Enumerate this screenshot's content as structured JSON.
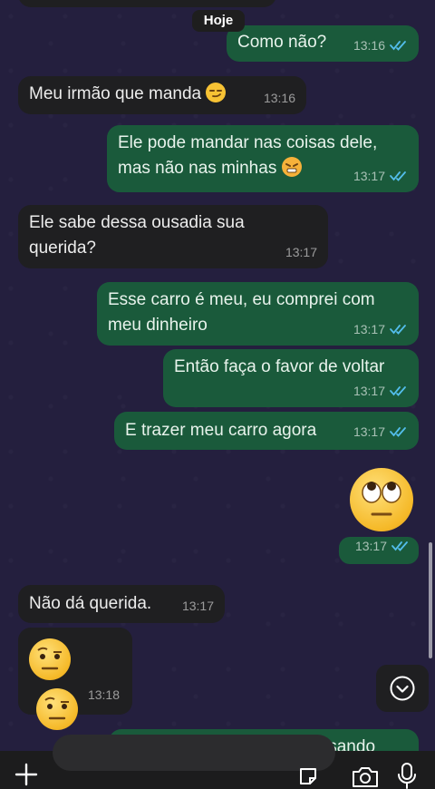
{
  "date_chip": "Hoje",
  "messages": [
    {
      "text": "Como não?",
      "time": "13:16",
      "dir": "out"
    },
    {
      "text": "Meu irmão que manda",
      "time": "13:16",
      "dir": "in"
    },
    {
      "line1": "Ele pode mandar nas coisas dele,",
      "line2": "mas não nas minhas",
      "time": "13:17",
      "dir": "out"
    },
    {
      "line1": "Ele sabe dessa ousadia sua",
      "line2": "querida?",
      "time": "13:17",
      "dir": "in"
    },
    {
      "line1": "Esse carro é meu, eu comprei com",
      "line2": "meu dinheiro",
      "time": "13:17",
      "dir": "out"
    },
    {
      "text": "Então faça o favor de voltar",
      "time": "13:17",
      "dir": "out"
    },
    {
      "text": "E trazer meu carro agora",
      "time": "13:17",
      "dir": "out"
    },
    {
      "emoji": "eye-roll",
      "time": "13:17",
      "dir": "out"
    },
    {
      "text": "Não dá querida.",
      "time": "13:17",
      "dir": "in"
    },
    {
      "emoji": "raised-eyebrow x2",
      "time": "13:18",
      "dir": "in"
    },
    {
      "text": "Acha que vou deixar ficar usando",
      "dir": "out"
    }
  ],
  "input": {
    "placeholder": "",
    "value": ""
  },
  "colors": {
    "outgoing": "#1a5a3b",
    "incoming": "#1f1f21",
    "background": "#241f3e",
    "read_ticks": "#53bdeb"
  }
}
